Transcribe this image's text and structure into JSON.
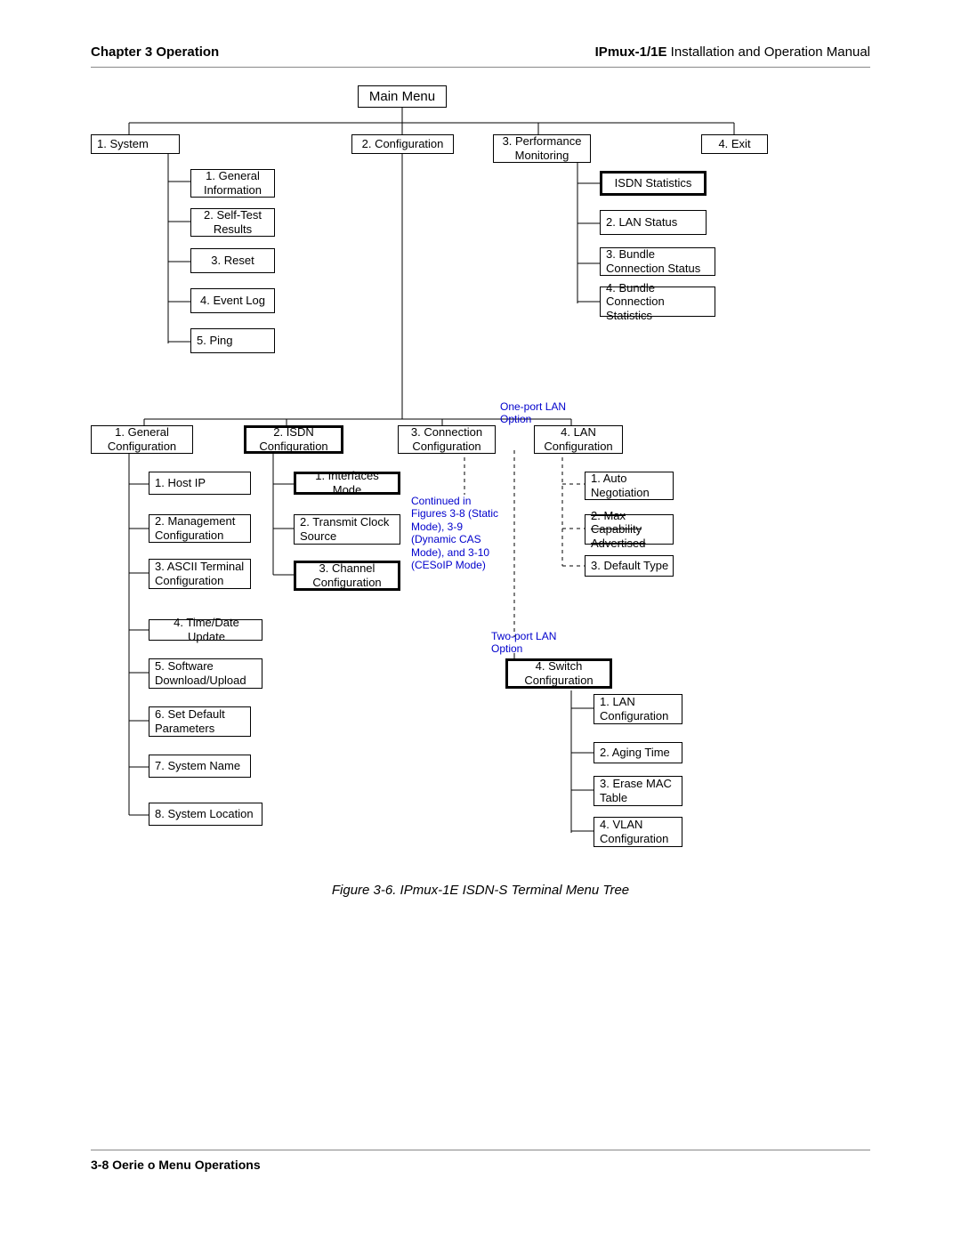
{
  "header": {
    "left": "Chapter 3  Operation",
    "right_bold": "IPmux-1/1E",
    "right_thin": " Installation and Operation Manual"
  },
  "caption": "Figure 3-6.  IPmux-1E ISDN-S Terminal Menu Tree",
  "footer": "3-8   Oerie o Menu Operations",
  "menu": {
    "root": "Main Menu",
    "level1": {
      "system": "1. System",
      "configuration": "2. Configuration",
      "performance": "3. Performance Monitoring",
      "exit": "4. Exit"
    },
    "system_children": [
      "1. General Information",
      "2. Self-Test Results",
      "3. Reset",
      "4. Event Log",
      "5. Ping"
    ],
    "perf_children": [
      "ISDN Statistics",
      "2. LAN Status",
      "3. Bundle Connection Status",
      "4. Bundle Connection Statistics"
    ],
    "config_children": {
      "general": "1. General Configuration",
      "isdn": "2. ISDN Configuration",
      "connection": "3. Connection Configuration",
      "lan": "4. LAN Configuration"
    },
    "general_cfg_children": [
      "1. Host IP",
      "2. Management Configuration",
      "3. ASCII Terminal Configuration",
      "4. Time/Date Update",
      "5. Software Download/Upload",
      "6. Set Default Parameters",
      "7. System Name",
      "8. System Location"
    ],
    "isdn_cfg_children": [
      "1. Interfaces Mode",
      "2. Transmit Clock Source",
      "3. Channel Configuration"
    ],
    "lan_one_children": [
      "1. Auto Negotiation",
      "2. Max Capability Advertised",
      "3. Default Type"
    ],
    "switch": "4. Switch Configuration",
    "switch_children": [
      "1. LAN Configuration",
      "2. Aging Time",
      "3. Erase MAC Table",
      "4. VLAN Configuration"
    ],
    "blue_labels": {
      "one_port": "One-port LAN Option",
      "continued": "Continued in Figures 3-8 (Static Mode), 3-9 (Dynamic CAS Mode), and 3-10 (CESoIP Mode)",
      "two_port": "Two-port LAN Option"
    }
  },
  "chart_data": {
    "type": "tree",
    "root": "Main Menu",
    "children": [
      {
        "label": "1. System",
        "children": [
          "1. General Information",
          "2. Self-Test Results",
          "3. Reset",
          "4. Event Log",
          "5. Ping"
        ]
      },
      {
        "label": "2. Configuration",
        "children": [
          {
            "label": "1. General Configuration",
            "children": [
              "1. Host IP",
              "2. Management Configuration",
              "3. ASCII Terminal Configuration",
              "4. Time/Date Update",
              "5. Software Download/Upload",
              "6. Set Default Parameters",
              "7. System Name",
              "8. System Location"
            ]
          },
          {
            "label": "2. ISDN Configuration",
            "children": [
              "1. Interfaces Mode",
              "2. Transmit Clock Source",
              "3. Channel Configuration"
            ]
          },
          {
            "label": "3. Connection Configuration",
            "note": "Continued in Figures 3-8 (Static Mode), 3-9 (Dynamic CAS Mode), and 3-10 (CESoIP Mode)"
          },
          {
            "label": "4. LAN Configuration",
            "branches": [
              {
                "option": "One-port LAN Option",
                "children": [
                  "1. Auto Negotiation",
                  "2. Max Capability Advertised",
                  "3. Default Type"
                ]
              },
              {
                "option": "Two-port LAN Option",
                "label": "4. Switch Configuration",
                "children": [
                  "1. LAN Configuration",
                  "2. Aging Time",
                  "3. Erase MAC Table",
                  "4. VLAN Configuration"
                ]
              }
            ]
          }
        ]
      },
      {
        "label": "3. Performance Monitoring",
        "children": [
          "ISDN Statistics",
          "2. LAN Status",
          "3. Bundle Connection Status",
          "4. Bundle Connection Statistics"
        ]
      },
      {
        "label": "4. Exit"
      }
    ]
  }
}
